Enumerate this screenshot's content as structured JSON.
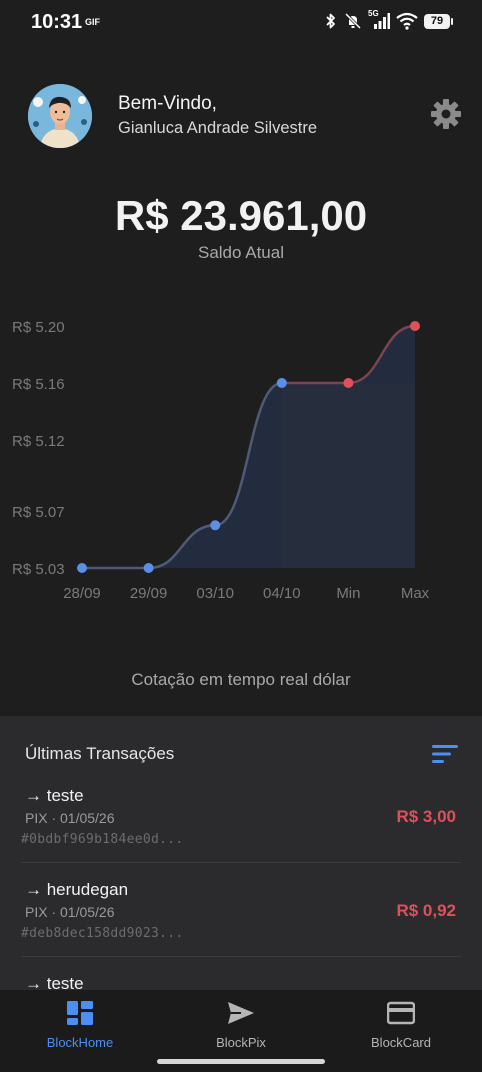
{
  "status": {
    "time": "10:31",
    "gif": "GIF",
    "battery": "79",
    "network": "5G"
  },
  "header": {
    "welcome": "Bem-Vindo,",
    "username": "Gianluca Andrade Silvestre"
  },
  "balance": {
    "amount": "R$ 23.961,00",
    "label": "Saldo Atual"
  },
  "chart_data": {
    "type": "line",
    "title": "",
    "x": [
      "28/09",
      "29/09",
      "03/10",
      "04/10",
      "Min",
      "Max"
    ],
    "series": [
      {
        "values": [
          5.03,
          5.03,
          5.06,
          5.16,
          5.16,
          5.2
        ]
      }
    ],
    "point_colors": [
      "#5b8ee6",
      "#5b8ee6",
      "#5b8ee6",
      "#5b8ee6",
      "#e0505a",
      "#e0505a"
    ],
    "yticks": [
      "R$ 5.20",
      "R$ 5.16",
      "R$ 5.12",
      "R$ 5.07",
      "R$ 5.03"
    ],
    "ytick_values": [
      5.2,
      5.16,
      5.12,
      5.07,
      5.03
    ],
    "ylim": [
      5.03,
      5.2
    ],
    "grid": false,
    "legend": "none"
  },
  "chart_caption": "Cotação em tempo real dólar",
  "transactions": {
    "title": "Últimas Transações",
    "items": [
      {
        "name": "→ teste",
        "meta": "PIX · 01/05/26",
        "hash": "#0bdbf969b184ee0d...",
        "amount": "R$ 3,00"
      },
      {
        "name": "→ herudegan",
        "meta": "PIX · 01/05/26",
        "hash": "#deb8dec158dd9023...",
        "amount": "R$ 0,92"
      },
      {
        "name": "→ teste",
        "meta": "",
        "hash": "",
        "amount": ""
      }
    ]
  },
  "nav": {
    "items": [
      {
        "label": "BlockHome",
        "icon": "dashboard-icon",
        "active": true
      },
      {
        "label": "BlockPix",
        "icon": "send-icon",
        "active": false
      },
      {
        "label": "BlockCard",
        "icon": "card-icon",
        "active": false
      }
    ]
  },
  "colors": {
    "accent": "#4c8ff0",
    "negative": "#e0505a",
    "background": "#1e1e1f",
    "panel": "#2b2b2d"
  }
}
